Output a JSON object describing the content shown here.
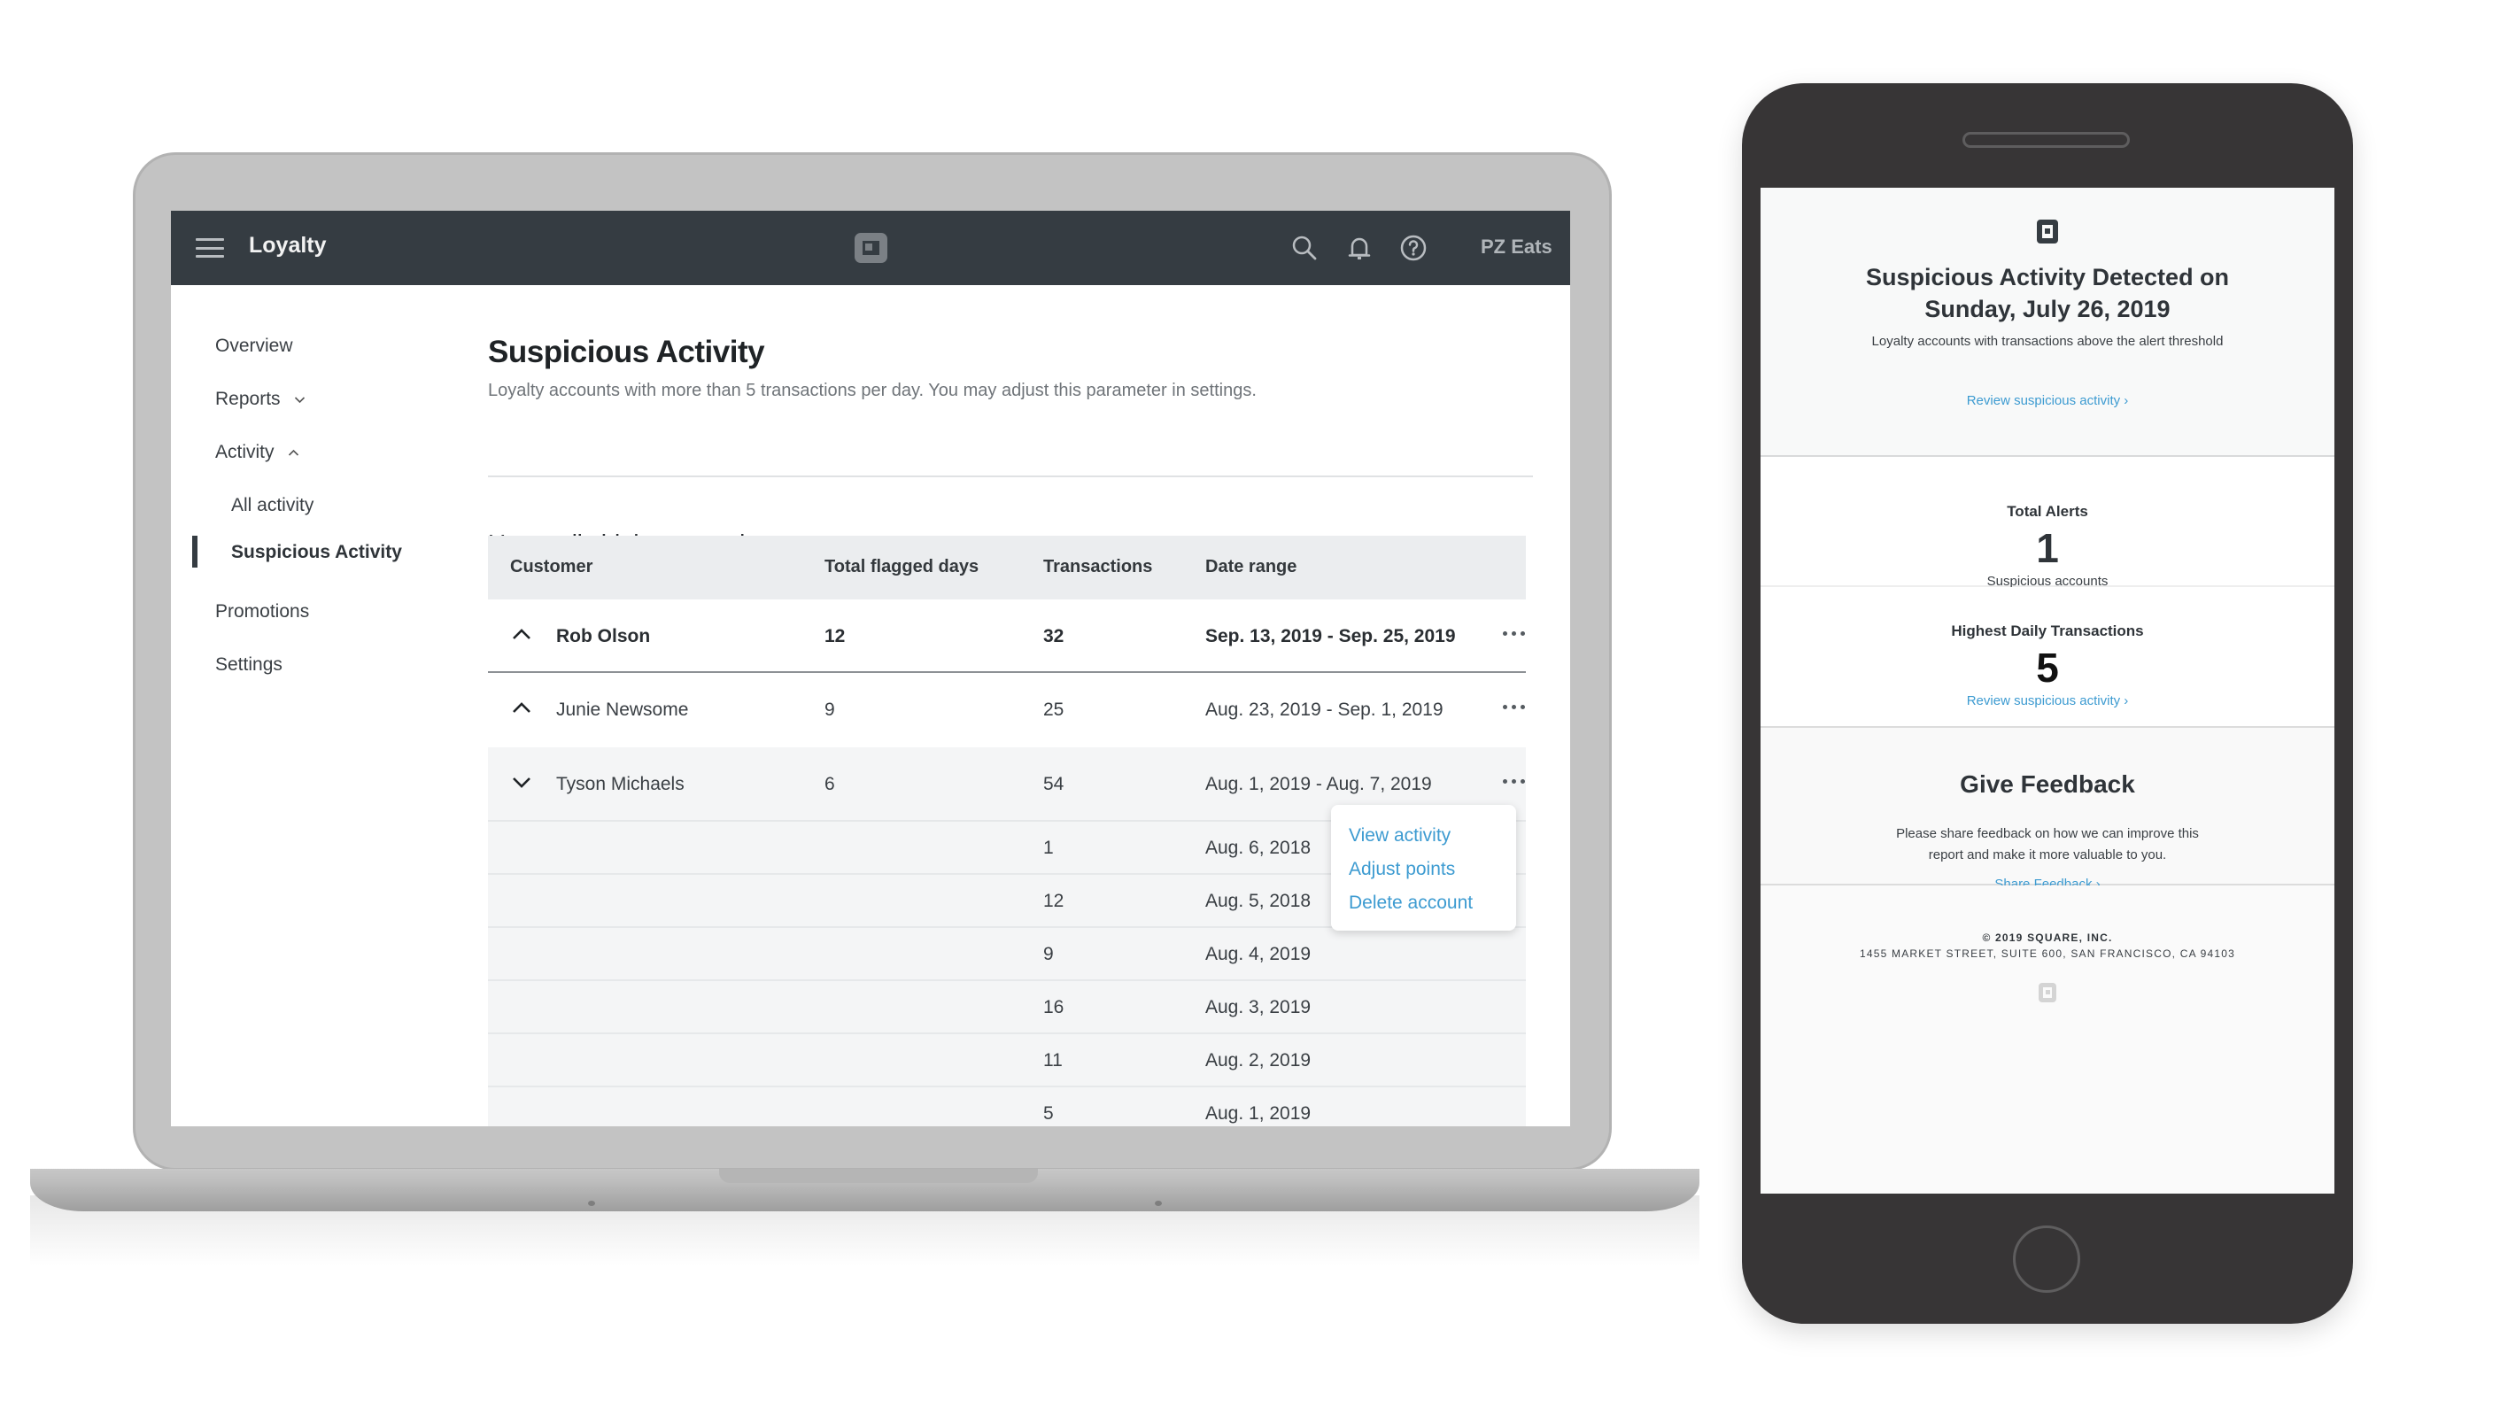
{
  "laptop": {
    "topbar": {
      "app_title": "Loyalty",
      "icons": [
        "menu-icon",
        "square-logo-icon",
        "search-icon",
        "bell-icon",
        "help-icon"
      ],
      "account_name": "PZ Eats"
    },
    "sidebar": {
      "items": [
        {
          "label": "Overview"
        },
        {
          "label": "Reports",
          "chevron": "down"
        },
        {
          "label": "Activity",
          "chevron": "up"
        },
        {
          "label": "All activity"
        },
        {
          "label": "Suspicious Activity",
          "active": true
        },
        {
          "label": "Promotions"
        },
        {
          "label": "Settings"
        }
      ]
    },
    "main": {
      "title": "Suspicious Activity",
      "subtitle": "Loyalty accounts with more than 5 transactions per day. You may adjust this parameter in settings.",
      "section_title": "Unusually high transactions",
      "table": {
        "headers": [
          "Customer",
          "Total flagged days",
          "Transactions",
          "Date range"
        ],
        "rows": [
          {
            "customer": "Rob Olson",
            "flagged_days": "12",
            "transactions": "32",
            "date_range": "Sep. 13, 2019 - Sep. 25, 2019",
            "caret": "up"
          },
          {
            "customer": "Junie Newsome",
            "flagged_days": "9",
            "transactions": "25",
            "date_range": "Aug. 23, 2019 - Sep. 1, 2019",
            "caret": "up"
          },
          {
            "customer": "Tyson Michaels",
            "flagged_days": "6",
            "transactions": "54",
            "date_range": "Aug. 1, 2019 - Aug. 7, 2019",
            "caret": "down"
          }
        ],
        "expanded_rows": [
          {
            "transactions": "1",
            "date": "Aug. 6, 2018"
          },
          {
            "transactions": "12",
            "date": "Aug. 5, 2018"
          },
          {
            "transactions": "9",
            "date": "Aug. 4, 2019"
          },
          {
            "transactions": "16",
            "date": "Aug. 3, 2019"
          },
          {
            "transactions": "11",
            "date": "Aug. 2, 2019"
          },
          {
            "transactions": "5",
            "date": "Aug. 1, 2019"
          }
        ]
      },
      "row_menu": {
        "items": [
          "View activity",
          "Adjust points",
          "Delete account"
        ]
      }
    }
  },
  "phone": {
    "header": {
      "title_line1": "Suspicious Activity Detected on",
      "title_line2": "Sunday, July 26, 2019",
      "subtitle": "Loyalty accounts with transactions above the alert threshold",
      "link": "Review suspicious activity ›"
    },
    "total_alerts": {
      "label": "Total Alerts",
      "value": "1",
      "caption": "Suspicious accounts"
    },
    "highest_daily": {
      "label": "Highest Daily Transactions",
      "value": "5",
      "link": "Review suspicious activity ›"
    },
    "feedback": {
      "title": "Give Feedback",
      "body_line1": "Please share feedback on how we can improve this",
      "body_line2": "report and make it more valuable to you.",
      "link": "Share Feedback ›"
    },
    "footer": {
      "copyright": "© 2019 SQUARE, INC.",
      "address": "1455 MARKET STREET, SUITE 600, SAN FRANCISCO, CA 94103"
    }
  },
  "colors": {
    "topbar": "#353c42",
    "link": "#3d9bd1",
    "phone_body": "#373536",
    "laptop_frame": "#c3c3c3"
  }
}
